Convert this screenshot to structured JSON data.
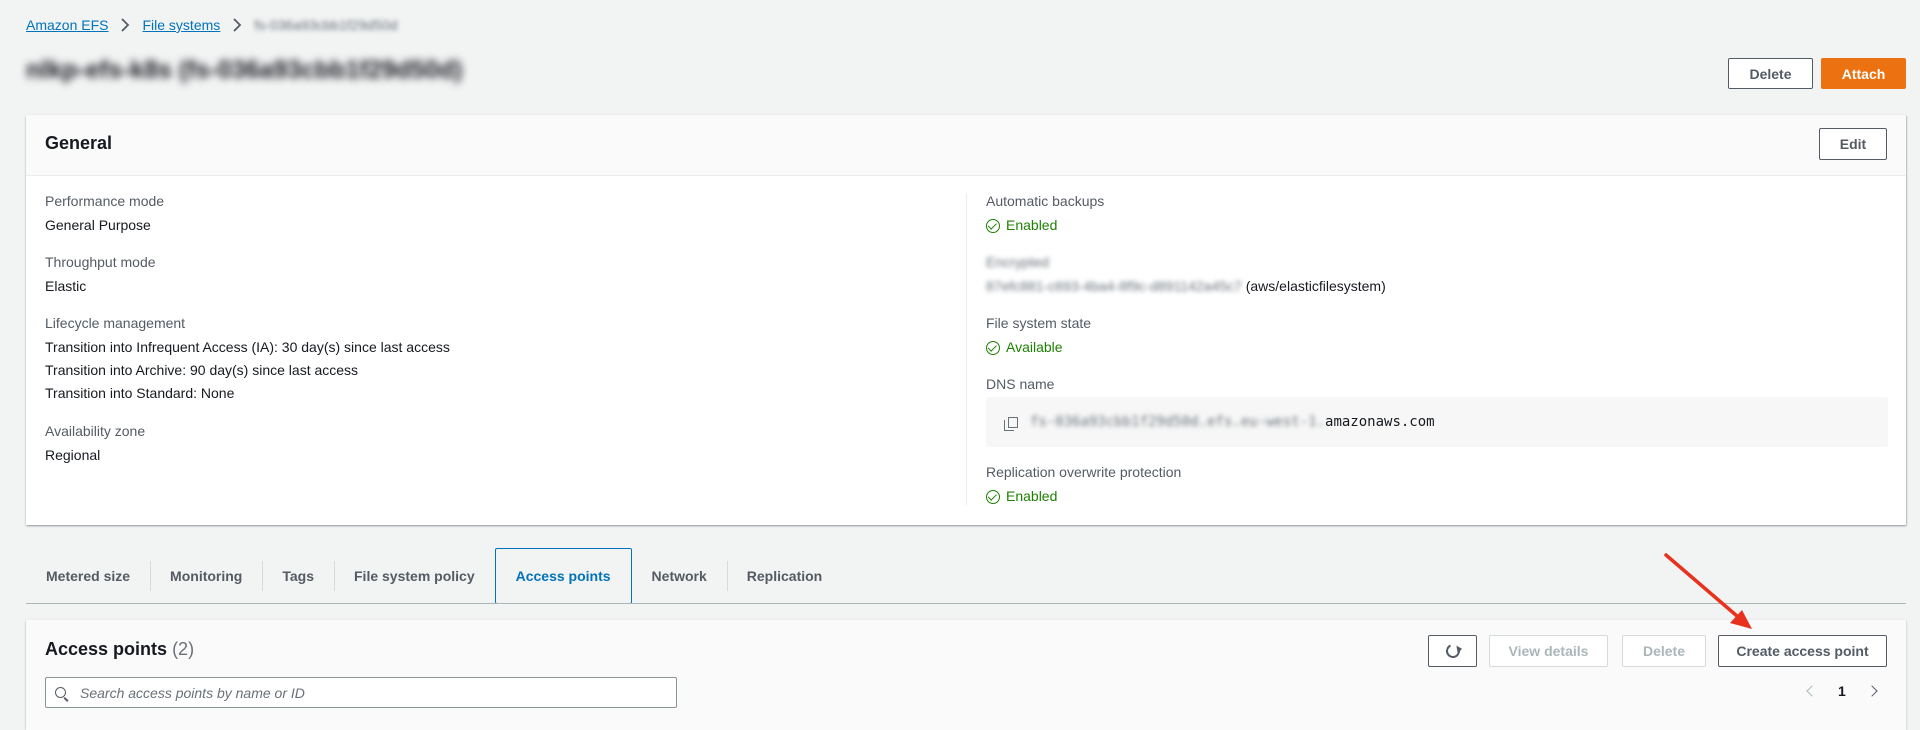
{
  "breadcrumb": {
    "root": "Amazon EFS",
    "parent": "File systems",
    "current": "fs-036a93cbb1f29d50d"
  },
  "page": {
    "title": "nlkp-efs-k8s (fs-036a93cbb1f29d50d)",
    "delete_label": "Delete",
    "attach_label": "Attach"
  },
  "general": {
    "title": "General",
    "edit_label": "Edit",
    "performance_mode_label": "Performance mode",
    "performance_mode_value": "General Purpose",
    "throughput_mode_label": "Throughput mode",
    "throughput_mode_value": "Elastic",
    "lifecycle_label": "Lifecycle management",
    "lifecycle_ia": "Transition into Infrequent Access (IA): 30 day(s) since last access",
    "lifecycle_archive": "Transition into Archive: 90 day(s) since last access",
    "lifecycle_standard": "Transition into Standard: None",
    "availability_zone_label": "Availability zone",
    "availability_zone_value": "Regional",
    "automatic_backups_label": "Automatic backups",
    "automatic_backups_value": "Enabled",
    "encrypted_label": "Encrypted",
    "encrypted_key": "87efc881-c693-4ba4-8f9c-d891142a45c7",
    "encrypted_suffix": "(aws/elasticfilesystem)",
    "fs_state_label": "File system state",
    "fs_state_value": "Available",
    "dns_label": "DNS name",
    "dns_prefix": "fs-036a93cbb1f29d50d.efs.eu-west-1.",
    "dns_suffix": "amazonaws.com",
    "replication_protection_label": "Replication overwrite protection",
    "replication_protection_value": "Enabled"
  },
  "tabs": [
    {
      "label": "Metered size"
    },
    {
      "label": "Monitoring"
    },
    {
      "label": "Tags"
    },
    {
      "label": "File system policy"
    },
    {
      "label": "Access points"
    },
    {
      "label": "Network"
    },
    {
      "label": "Replication"
    }
  ],
  "active_tab": "Access points",
  "access_points": {
    "title": "Access points",
    "count": "(2)",
    "view_details_label": "View details",
    "delete_label": "Delete",
    "create_label": "Create access point",
    "search_placeholder": "Search access points by name or ID",
    "page_number": "1"
  },
  "colors": {
    "accent": "#0073bb",
    "primary_button": "#ec7211",
    "status_ok": "#1d8102",
    "annotation_arrow": "#e8321e"
  }
}
